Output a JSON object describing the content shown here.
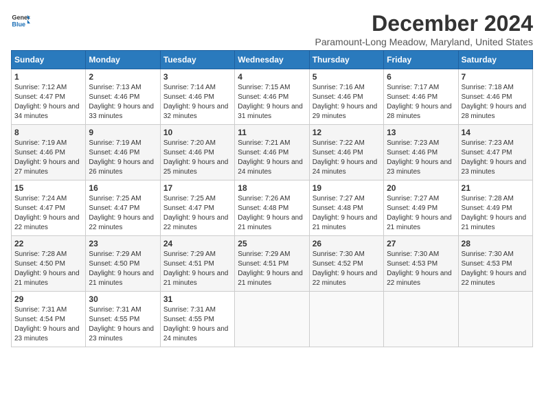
{
  "header": {
    "logo_general": "General",
    "logo_blue": "Blue",
    "month_title": "December 2024",
    "location": "Paramount-Long Meadow, Maryland, United States"
  },
  "weekdays": [
    "Sunday",
    "Monday",
    "Tuesday",
    "Wednesday",
    "Thursday",
    "Friday",
    "Saturday"
  ],
  "weeks": [
    [
      {
        "day": "1",
        "sunrise": "7:12 AM",
        "sunset": "4:47 PM",
        "daylight": "9 hours and 34 minutes."
      },
      {
        "day": "2",
        "sunrise": "7:13 AM",
        "sunset": "4:46 PM",
        "daylight": "9 hours and 33 minutes."
      },
      {
        "day": "3",
        "sunrise": "7:14 AM",
        "sunset": "4:46 PM",
        "daylight": "9 hours and 32 minutes."
      },
      {
        "day": "4",
        "sunrise": "7:15 AM",
        "sunset": "4:46 PM",
        "daylight": "9 hours and 31 minutes."
      },
      {
        "day": "5",
        "sunrise": "7:16 AM",
        "sunset": "4:46 PM",
        "daylight": "9 hours and 29 minutes."
      },
      {
        "day": "6",
        "sunrise": "7:17 AM",
        "sunset": "4:46 PM",
        "daylight": "9 hours and 28 minutes."
      },
      {
        "day": "7",
        "sunrise": "7:18 AM",
        "sunset": "4:46 PM",
        "daylight": "9 hours and 28 minutes."
      }
    ],
    [
      {
        "day": "8",
        "sunrise": "7:19 AM",
        "sunset": "4:46 PM",
        "daylight": "9 hours and 27 minutes."
      },
      {
        "day": "9",
        "sunrise": "7:19 AM",
        "sunset": "4:46 PM",
        "daylight": "9 hours and 26 minutes."
      },
      {
        "day": "10",
        "sunrise": "7:20 AM",
        "sunset": "4:46 PM",
        "daylight": "9 hours and 25 minutes."
      },
      {
        "day": "11",
        "sunrise": "7:21 AM",
        "sunset": "4:46 PM",
        "daylight": "9 hours and 24 minutes."
      },
      {
        "day": "12",
        "sunrise": "7:22 AM",
        "sunset": "4:46 PM",
        "daylight": "9 hours and 24 minutes."
      },
      {
        "day": "13",
        "sunrise": "7:23 AM",
        "sunset": "4:46 PM",
        "daylight": "9 hours and 23 minutes."
      },
      {
        "day": "14",
        "sunrise": "7:23 AM",
        "sunset": "4:47 PM",
        "daylight": "9 hours and 23 minutes."
      }
    ],
    [
      {
        "day": "15",
        "sunrise": "7:24 AM",
        "sunset": "4:47 PM",
        "daylight": "9 hours and 22 minutes."
      },
      {
        "day": "16",
        "sunrise": "7:25 AM",
        "sunset": "4:47 PM",
        "daylight": "9 hours and 22 minutes."
      },
      {
        "day": "17",
        "sunrise": "7:25 AM",
        "sunset": "4:47 PM",
        "daylight": "9 hours and 22 minutes."
      },
      {
        "day": "18",
        "sunrise": "7:26 AM",
        "sunset": "4:48 PM",
        "daylight": "9 hours and 21 minutes."
      },
      {
        "day": "19",
        "sunrise": "7:27 AM",
        "sunset": "4:48 PM",
        "daylight": "9 hours and 21 minutes."
      },
      {
        "day": "20",
        "sunrise": "7:27 AM",
        "sunset": "4:49 PM",
        "daylight": "9 hours and 21 minutes."
      },
      {
        "day": "21",
        "sunrise": "7:28 AM",
        "sunset": "4:49 PM",
        "daylight": "9 hours and 21 minutes."
      }
    ],
    [
      {
        "day": "22",
        "sunrise": "7:28 AM",
        "sunset": "4:50 PM",
        "daylight": "9 hours and 21 minutes."
      },
      {
        "day": "23",
        "sunrise": "7:29 AM",
        "sunset": "4:50 PM",
        "daylight": "9 hours and 21 minutes."
      },
      {
        "day": "24",
        "sunrise": "7:29 AM",
        "sunset": "4:51 PM",
        "daylight": "9 hours and 21 minutes."
      },
      {
        "day": "25",
        "sunrise": "7:29 AM",
        "sunset": "4:51 PM",
        "daylight": "9 hours and 21 minutes."
      },
      {
        "day": "26",
        "sunrise": "7:30 AM",
        "sunset": "4:52 PM",
        "daylight": "9 hours and 22 minutes."
      },
      {
        "day": "27",
        "sunrise": "7:30 AM",
        "sunset": "4:53 PM",
        "daylight": "9 hours and 22 minutes."
      },
      {
        "day": "28",
        "sunrise": "7:30 AM",
        "sunset": "4:53 PM",
        "daylight": "9 hours and 22 minutes."
      }
    ],
    [
      {
        "day": "29",
        "sunrise": "7:31 AM",
        "sunset": "4:54 PM",
        "daylight": "9 hours and 23 minutes."
      },
      {
        "day": "30",
        "sunrise": "7:31 AM",
        "sunset": "4:55 PM",
        "daylight": "9 hours and 23 minutes."
      },
      {
        "day": "31",
        "sunrise": "7:31 AM",
        "sunset": "4:55 PM",
        "daylight": "9 hours and 24 minutes."
      },
      null,
      null,
      null,
      null
    ]
  ],
  "labels": {
    "sunrise": "Sunrise:",
    "sunset": "Sunset:",
    "daylight": "Daylight hours"
  }
}
